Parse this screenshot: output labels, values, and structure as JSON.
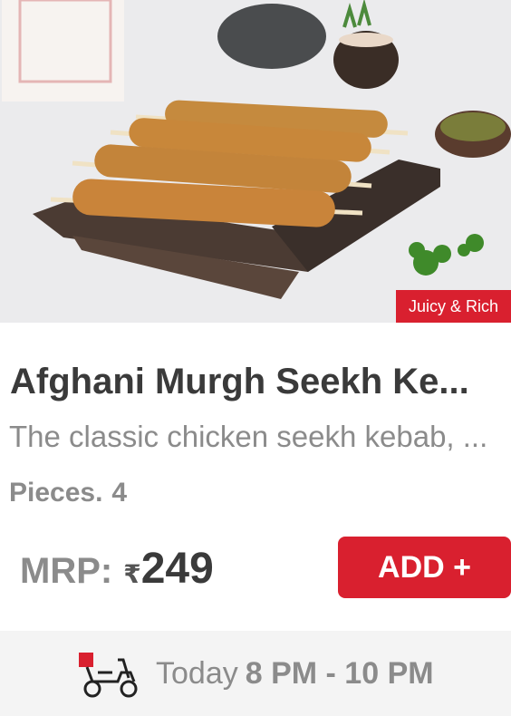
{
  "product": {
    "badge": "Juicy & Rich",
    "title": "Afghani Murgh Seekh Ke...",
    "description": "The classic chicken seekh kebab, ...",
    "pieces_label": "Pieces.",
    "pieces_value": "4",
    "mrp_label": "MRP:",
    "currency": "₹",
    "price": "249",
    "add_label": "ADD +"
  },
  "delivery": {
    "day": "Today",
    "time": "8 PM - 10 PM",
    "icon": "delivery-scooter-icon"
  },
  "colors": {
    "accent": "#d9202f",
    "text_dark": "#3a3a3a",
    "text_muted": "#8b8b8b",
    "footer_bg": "#f4f4f4"
  }
}
